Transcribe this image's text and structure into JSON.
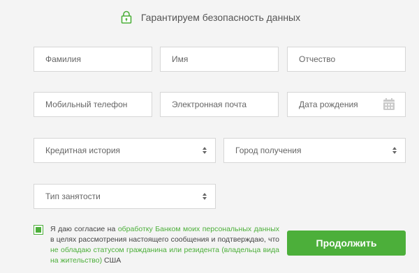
{
  "header": {
    "secure_text": "Гарантируем безопасность данных"
  },
  "fields": {
    "last_name": "Фамилия",
    "first_name": "Имя",
    "middle_name": "Отчество",
    "mobile_phone": "Мобильный телефон",
    "email": "Электронная почта",
    "birth_date": "Дата рождения",
    "credit_history": "Кредитная история",
    "city": "Город получения",
    "employment_type": "Тип занятости"
  },
  "consent": {
    "checked": true,
    "text_1": "Я даю согласие на ",
    "link_1": "обработку Банком моих персональных данных",
    "text_2": " в целях рассмотрения настоящего сообщения и подтверждаю, что ",
    "link_2": "не обладаю статусом гражданина или резидента (владельца вида на жительство)",
    "text_3": " США"
  },
  "actions": {
    "continue_label": "Продолжить"
  },
  "colors": {
    "accent": "#4caf3a",
    "background": "#f4f4f4",
    "field_border": "#d6d6d6"
  }
}
